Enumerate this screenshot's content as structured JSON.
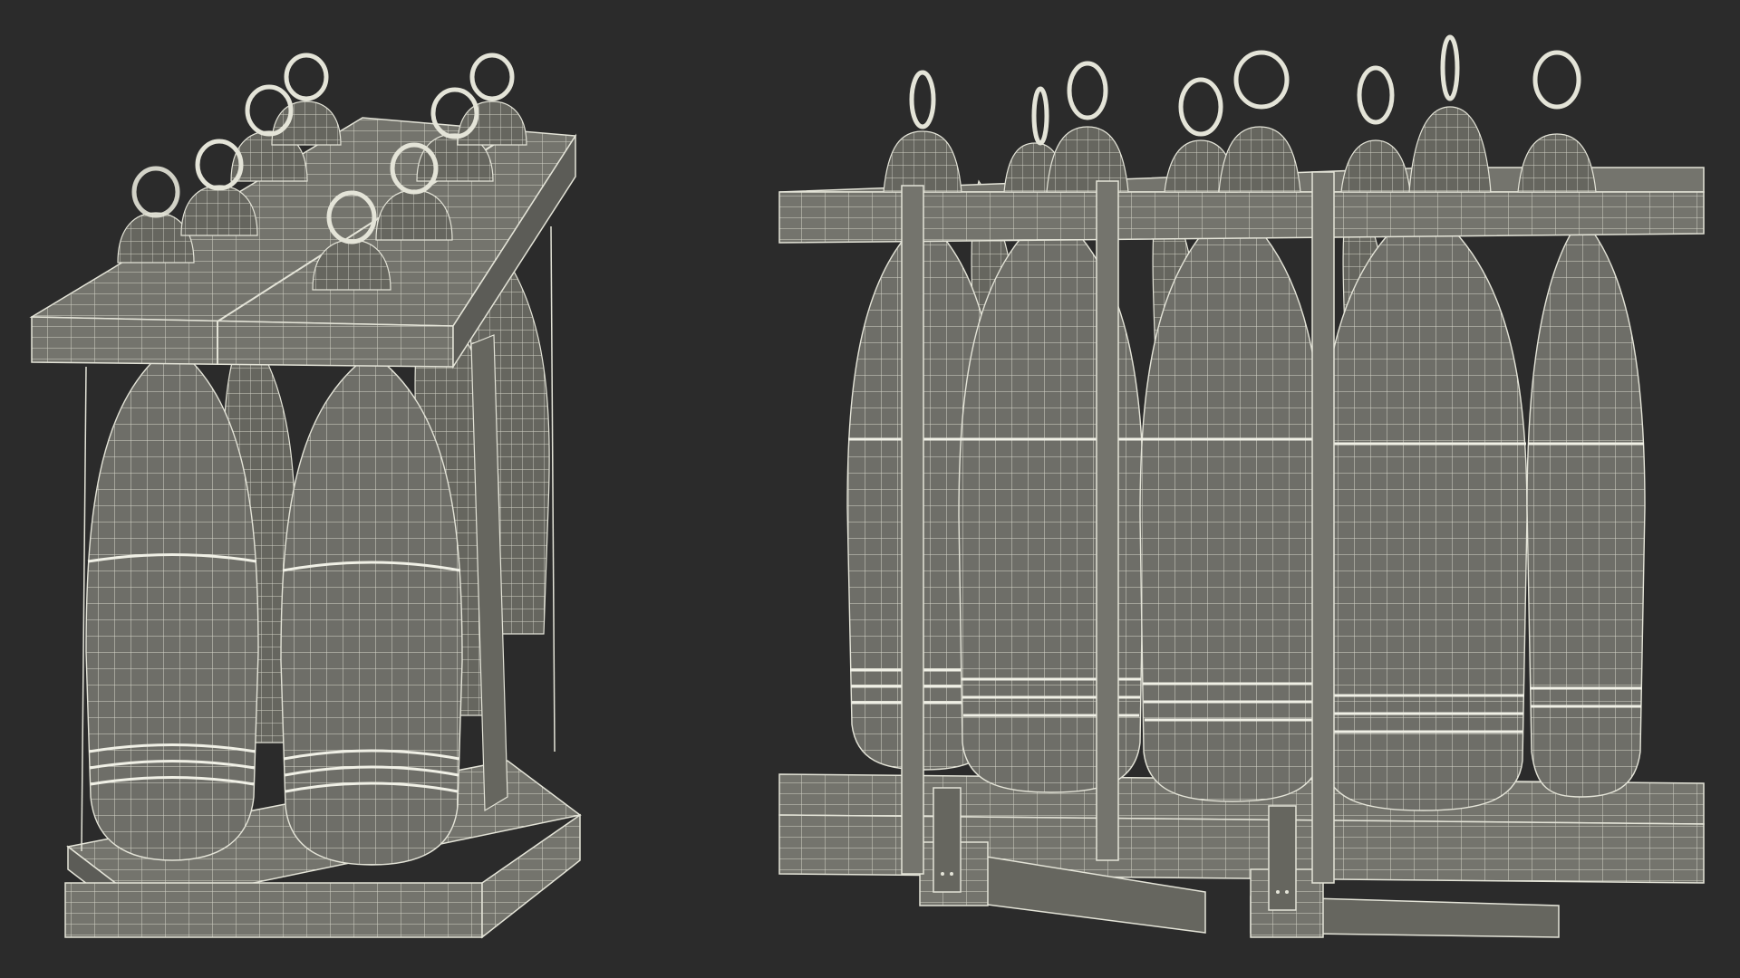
{
  "scene": {
    "background_color": "#2b2b2b",
    "mesh_fill": "#6e6e68",
    "mesh_fill_dark": "#5c5c57",
    "wire_color": "#e4e4d8",
    "views": [
      {
        "name": "pallet-view-angled",
        "shell_count": 8
      },
      {
        "name": "pallet-view-front",
        "shell_count": 8
      }
    ]
  }
}
